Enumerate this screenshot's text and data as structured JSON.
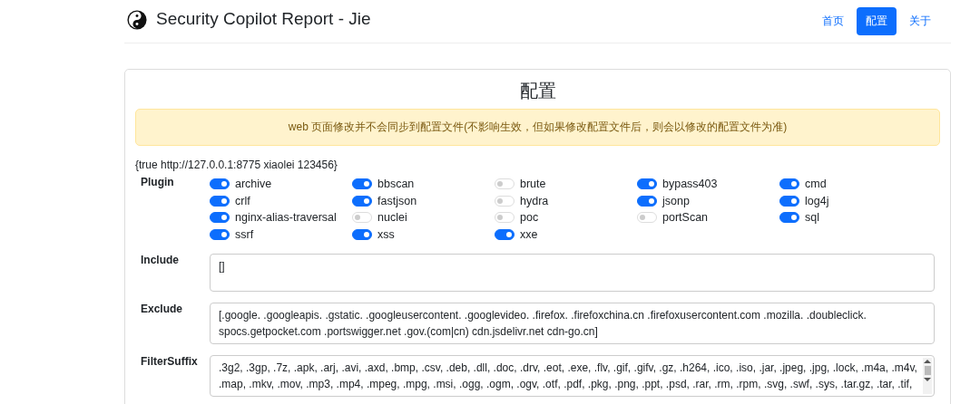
{
  "header": {
    "title": "Security Copilot Report - Jie",
    "nav": [
      {
        "label": "首页",
        "selected": false
      },
      {
        "label": "配置",
        "selected": true
      },
      {
        "label": "关于",
        "selected": false
      }
    ]
  },
  "card": {
    "title": "配置",
    "alert": "web 页面修改并不会同步到配置文件(不影响生效，但如果修改配置文件后，则会以修改的配置文件为准)",
    "info": "{true http://127.0.0.1:8775 xiaolei 123456}",
    "plugin_label": "Plugin",
    "plugins": [
      {
        "name": "archive",
        "on": true
      },
      {
        "name": "bbscan",
        "on": true
      },
      {
        "name": "brute",
        "on": false
      },
      {
        "name": "bypass403",
        "on": true
      },
      {
        "name": "cmd",
        "on": true
      },
      {
        "name": "crlf",
        "on": true
      },
      {
        "name": "fastjson",
        "on": true
      },
      {
        "name": "hydra",
        "on": false
      },
      {
        "name": "jsonp",
        "on": true
      },
      {
        "name": "log4j",
        "on": true
      },
      {
        "name": "nginx-alias-traversal",
        "on": true
      },
      {
        "name": "nuclei",
        "on": false
      },
      {
        "name": "poc",
        "on": false
      },
      {
        "name": "portScan",
        "on": false
      },
      {
        "name": "sql",
        "on": true
      },
      {
        "name": "ssrf",
        "on": true
      },
      {
        "name": "xss",
        "on": true
      },
      {
        "name": "xxe",
        "on": true
      }
    ],
    "fields": [
      {
        "label": "Include",
        "lines": [
          "[]"
        ],
        "scrollbar": false
      },
      {
        "label": "Exclude",
        "lines": [
          "[.google. .googleapis. .gstatic. .googleusercontent. .googlevideo. .firefox. .firefoxchina.cn .firefoxusercontent.com .mozilla. .doubleclick.",
          "spocs.getpocket.com .portswigger.net .gov.(com|cn) cdn.jsdelivr.net cdn-go.cn]"
        ],
        "scrollbar": false
      },
      {
        "label": "FilterSuffix",
        "lines": [
          ".3g2, .3gp, .7z, .apk, .arj, .avi, .axd, .bmp, .csv, .deb, .dll, .doc, .drv, .eot, .exe, .flv, .gif, .gifv, .gz, .h264, .ico, .iso, .jar, .jpeg, .jpg, .lock, .m4a, .m4v,",
          ".map, .mkv, .mov, .mp3, .mp4, .mpeg, .mpg, .msi, .ogg, .ogm, .ogv, .otf, .pdf, .pkg, .png, .ppt, .psd, .rar, .rm, .rpm, .svg, .swf, .sys, .tar.gz, .tar, .tif,"
        ],
        "scrollbar": true
      }
    ]
  }
}
